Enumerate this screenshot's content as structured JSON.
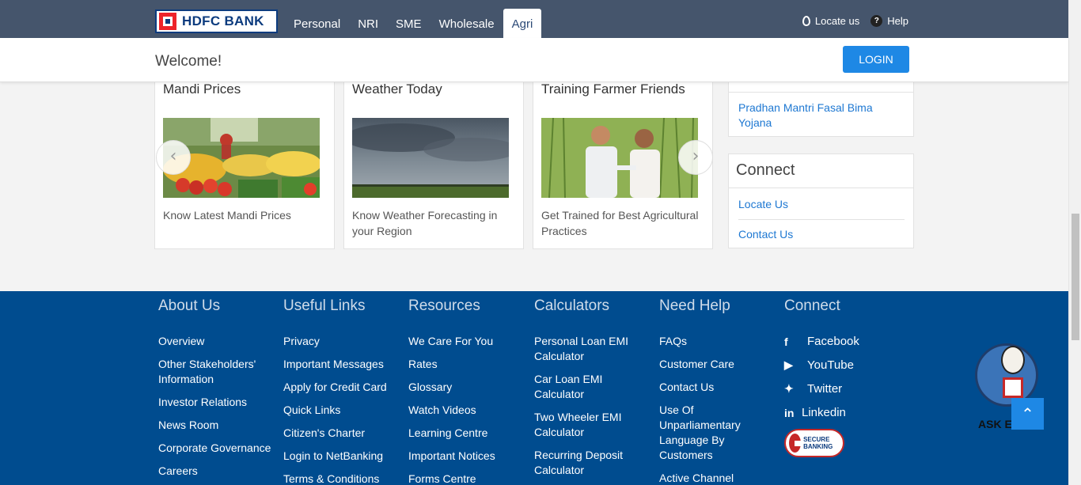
{
  "header": {
    "logo_text": "HDFC BANK",
    "nav": [
      "Personal",
      "NRI",
      "SME",
      "Wholesale",
      "Agri"
    ],
    "active_nav": "Agri",
    "locate_label": "Locate us",
    "help_label": "Help"
  },
  "welcome": {
    "text": "Welcome!",
    "login_label": "LOGIN"
  },
  "cards": [
    {
      "title": "Mandi Prices",
      "desc": "Know Latest Mandi Prices",
      "image": "vegetable market stall"
    },
    {
      "title": "Weather Today",
      "desc": "Know Weather Forecasting in your Region",
      "image": "storm clouds over field"
    },
    {
      "title": "Training Farmer Friends",
      "desc": "Get Trained for Best Agricultural Practices",
      "image": "two men in crop field"
    }
  ],
  "side": {
    "scheme_link": "Pradhan Mantri Fasal Bima Yojana",
    "connect_title": "Connect",
    "connect_links": [
      "Locate Us",
      "Contact Us"
    ]
  },
  "footer": {
    "columns": [
      {
        "heading": "About Us",
        "links": [
          "Overview",
          "Other Stakeholders' Information",
          "Investor Relations",
          "News Room",
          "Corporate Governance",
          "Careers"
        ]
      },
      {
        "heading": "Useful Links",
        "links": [
          "Privacy",
          "Important Messages",
          "Apply for Credit Card",
          "Quick Links",
          "Citizen's Charter",
          "Login to NetBanking",
          "Terms & Conditions"
        ]
      },
      {
        "heading": "Resources",
        "links": [
          "We Care For You",
          "Rates",
          "Glossary",
          "Watch Videos",
          "Learning Centre",
          "Important Notices",
          "Forms Centre"
        ]
      },
      {
        "heading": "Calculators",
        "links": [
          "Personal Loan EMI Calculator",
          "Car Loan EMI Calculator",
          "Two Wheeler EMI Calculator",
          "Recurring Deposit Calculator"
        ]
      },
      {
        "heading": "Need Help",
        "links": [
          "FAQs",
          "Customer Care",
          "Contact Us",
          "Use Of Unparliamentary Language By Customers",
          "Active Channel"
        ]
      }
    ],
    "connect": {
      "heading": "Connect",
      "social": [
        {
          "icon": "facebook-icon",
          "label": "Facebook"
        },
        {
          "icon": "youtube-icon",
          "label": "YouTube"
        },
        {
          "icon": "twitter-icon",
          "label": "Twitter"
        },
        {
          "icon": "linkedin-icon",
          "label": "Linkedin"
        }
      ],
      "secure_badge": "SECURE BANKING"
    }
  },
  "eva_label": "ASK EVA",
  "colors": {
    "nav_bg": "#45556c",
    "footer_bg": "#004c8f",
    "accent": "#1e88e5",
    "link": "#1e78d2"
  }
}
